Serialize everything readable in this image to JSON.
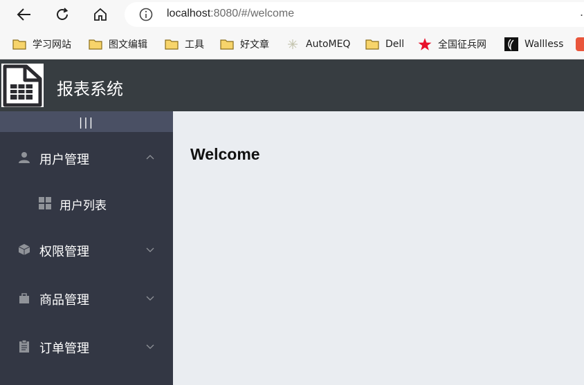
{
  "browser": {
    "url_host": "localhost",
    "url_rest": ":8080/#/welcome",
    "overflow_char": "."
  },
  "bookmarks": [
    {
      "label": "学习网站",
      "icon": "folder-icon"
    },
    {
      "label": "图文编辑",
      "icon": "folder-icon"
    },
    {
      "label": "工具",
      "icon": "folder-icon"
    },
    {
      "label": "好文章",
      "icon": "folder-icon"
    },
    {
      "label": "AutoMEQ",
      "icon": "automeq-favicon-icon"
    },
    {
      "label": "Dell",
      "icon": "folder-icon"
    },
    {
      "label": "全国征兵网",
      "icon": "star-icon"
    },
    {
      "label": "Wallless",
      "icon": "wallless-favicon-icon"
    }
  ],
  "app": {
    "title": "报表系统",
    "toggle_label": "|||"
  },
  "sidebar": {
    "items": [
      {
        "label": "用户管理",
        "icon": "user-icon",
        "expanded": true
      },
      {
        "label": "用户列表",
        "icon": "grid-icon",
        "sub": true
      },
      {
        "label": "权限管理",
        "icon": "box-icon",
        "expanded": false
      },
      {
        "label": "商品管理",
        "icon": "bag-icon",
        "expanded": false
      },
      {
        "label": "订单管理",
        "icon": "clipboard-icon",
        "expanded": false
      }
    ]
  },
  "main": {
    "heading": "Welcome"
  },
  "colors": {
    "header_bg": "#373d41",
    "sidebar_bg": "#333744",
    "toggle_bg": "#4a5064",
    "main_bg": "#eaedf1"
  }
}
